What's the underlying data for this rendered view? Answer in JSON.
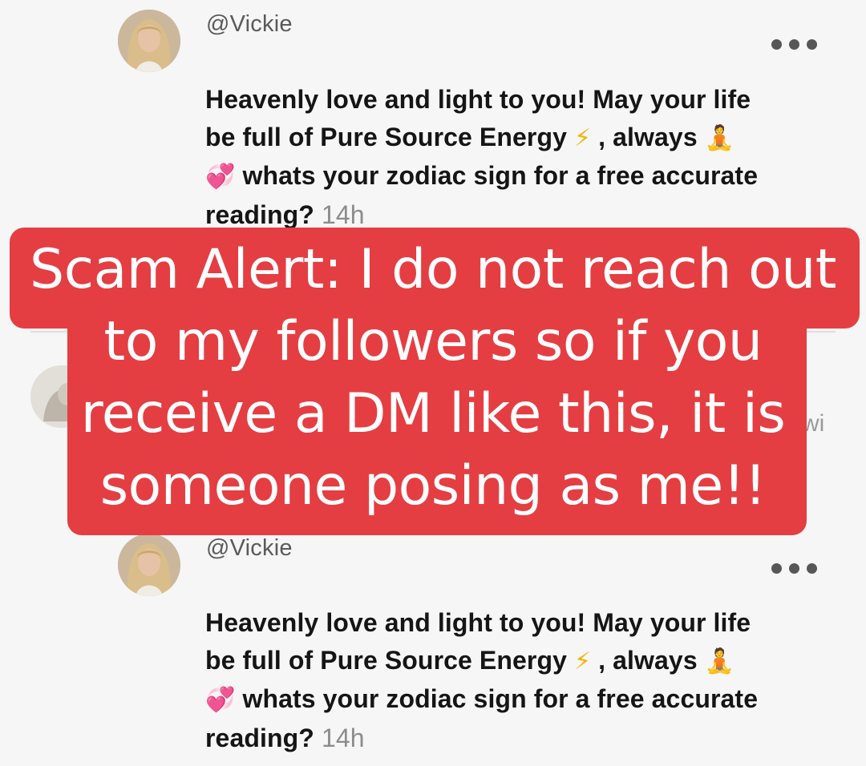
{
  "comments": [
    {
      "username": "@Vickie",
      "line1": "Heavenly love and light to you! May your life",
      "line2_text": "be full of Pure Source Energy",
      "line2_after": ", always",
      "line3_text": "whats your zodiac sign for a free accurate",
      "line4_text": "reading?",
      "timestamp": "14h",
      "emoji_bolt": "⚡",
      "emoji_yoga": "🧘",
      "emoji_hearts": "💞"
    },
    {
      "username": "@Vickie",
      "line1": "Heavenly love and light to you! May your life",
      "line2_text": "be full of Pure Source Energy",
      "line2_after": ", always",
      "line3_text": "whats your zodiac sign for a free accurate",
      "line4_text": "reading?",
      "timestamp": "14h",
      "emoji_bolt": "⚡",
      "emoji_yoga": "🧘",
      "emoji_hearts": "💞"
    }
  ],
  "middle_comment": {
    "partial_text": "wi"
  },
  "overlay": {
    "line1": "Scam Alert: I do not reach out",
    "line2": "to my followers so if you",
    "line3": "receive a DM like this, it is",
    "line4": "someone posing as me!!"
  },
  "colors": {
    "banner": "#e43e43",
    "background": "#f6f6f6",
    "text": "#151515",
    "muted": "#8c8c8c"
  }
}
